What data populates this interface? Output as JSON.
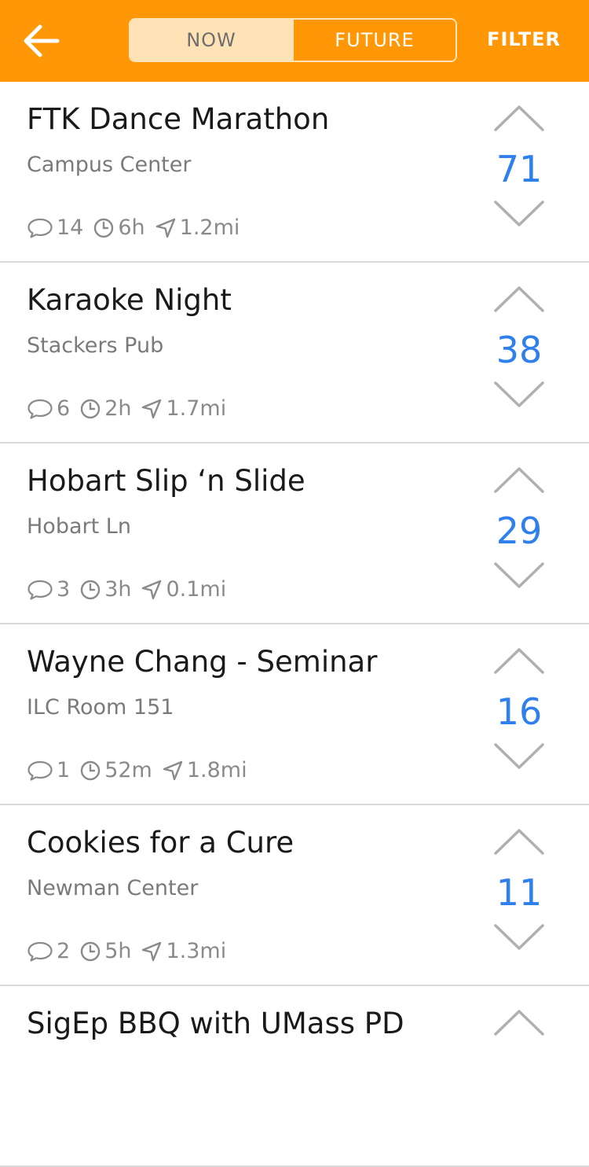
{
  "header": {
    "segments": [
      "NOW",
      "FUTURE"
    ],
    "active_segment": 0,
    "filter_label": "FILTER"
  },
  "events": [
    {
      "title": "FTK Dance Marathon",
      "location": "Campus Center",
      "comments": "14",
      "time": "6h",
      "distance": "1.2mi",
      "votes": "71"
    },
    {
      "title": "Karaoke Night",
      "location": "Stackers Pub",
      "comments": "6",
      "time": "2h",
      "distance": "1.7mi",
      "votes": "38"
    },
    {
      "title": "Hobart Slip ‘n Slide",
      "location": "Hobart Ln",
      "comments": "3",
      "time": "3h",
      "distance": "0.1mi",
      "votes": "29"
    },
    {
      "title": "Wayne Chang - Seminar",
      "location": "ILC Room 151",
      "comments": "1",
      "time": "52m",
      "distance": "1.8mi",
      "votes": "16"
    },
    {
      "title": "Cookies for a Cure",
      "location": "Newman Center",
      "comments": "2",
      "time": "5h",
      "distance": "1.3mi",
      "votes": "11"
    },
    {
      "title": "SigEp BBQ with UMass PD",
      "location": "",
      "comments": "",
      "time": "",
      "distance": "",
      "votes": ""
    }
  ],
  "icons": {
    "back": "arrow-left-icon",
    "comment": "speech-bubble-icon",
    "time": "clock-icon",
    "distance": "location-arrow-icon",
    "upvote": "chevron-up-icon",
    "downvote": "chevron-down-icon"
  },
  "colors": {
    "header": "#ff9706",
    "segment_active": "#ffe2b5",
    "vote_count": "#2f80ed"
  }
}
